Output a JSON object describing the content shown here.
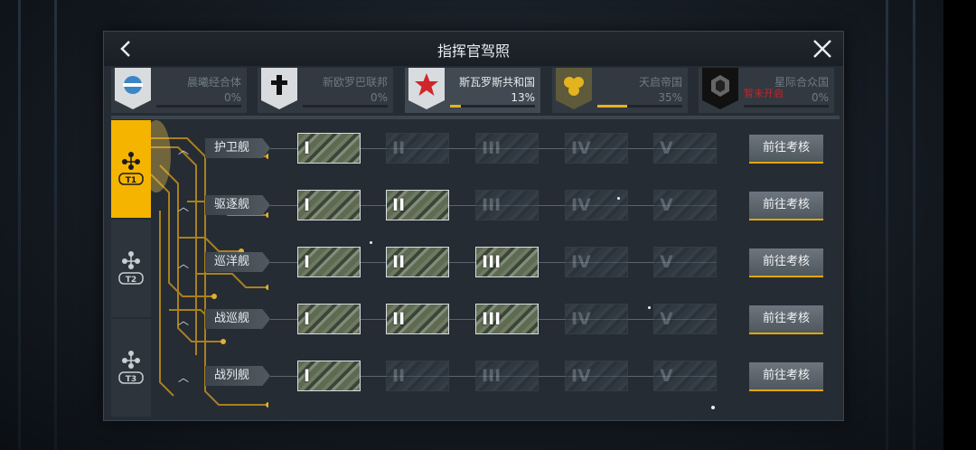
{
  "header": {
    "title": "指挥官驾照",
    "back_icon": "chevron-left-icon",
    "close_icon": "close-icon"
  },
  "factions": [
    {
      "name": "晨曦经合体",
      "percent": "0%",
      "progress": 0.0,
      "color": "#3b86c6",
      "icon": "orbit-emblem-icon",
      "active": false
    },
    {
      "name": "新欧罗巴联邦",
      "percent": "0%",
      "progress": 0.0,
      "color": "#111111",
      "icon": "cross-emblem-icon",
      "active": false
    },
    {
      "name": "斯瓦罗斯共和国",
      "percent": "13%",
      "progress": 0.13,
      "color": "#d0262b",
      "icon": "star-emblem-icon",
      "active": true
    },
    {
      "name": "天启帝国",
      "percent": "35%",
      "progress": 0.35,
      "color": "#e4b320",
      "icon": "cluster-emblem-icon",
      "active": false
    },
    {
      "name": "星际合众国",
      "percent": "0%",
      "progress": 0.0,
      "color": "#1d1d1d",
      "icon": "hex-emblem-icon",
      "active": false,
      "locked_label": "暂未开启"
    }
  ],
  "tiers": [
    {
      "label": "T1",
      "icon": "t1-tier-icon",
      "active": true
    },
    {
      "label": "T2",
      "icon": "t2-tier-icon",
      "active": false
    },
    {
      "label": "T3",
      "icon": "t3-tier-icon",
      "active": false
    }
  ],
  "ship_rows": [
    {
      "label": "护卫舰",
      "unlocked": 1,
      "action": "前往考核"
    },
    {
      "label": "驱逐舰",
      "unlocked": 2,
      "action": "前往考核"
    },
    {
      "label": "巡洋舰",
      "unlocked": 3,
      "action": "前往考核"
    },
    {
      "label": "战巡舰",
      "unlocked": 3,
      "action": "前往考核"
    },
    {
      "label": "战列舰",
      "unlocked": 1,
      "action": "前往考核"
    }
  ],
  "levels": [
    "I",
    "II",
    "III",
    "IV",
    "V"
  ],
  "colors": {
    "accent": "#f4b400",
    "panel": "#262c33"
  }
}
